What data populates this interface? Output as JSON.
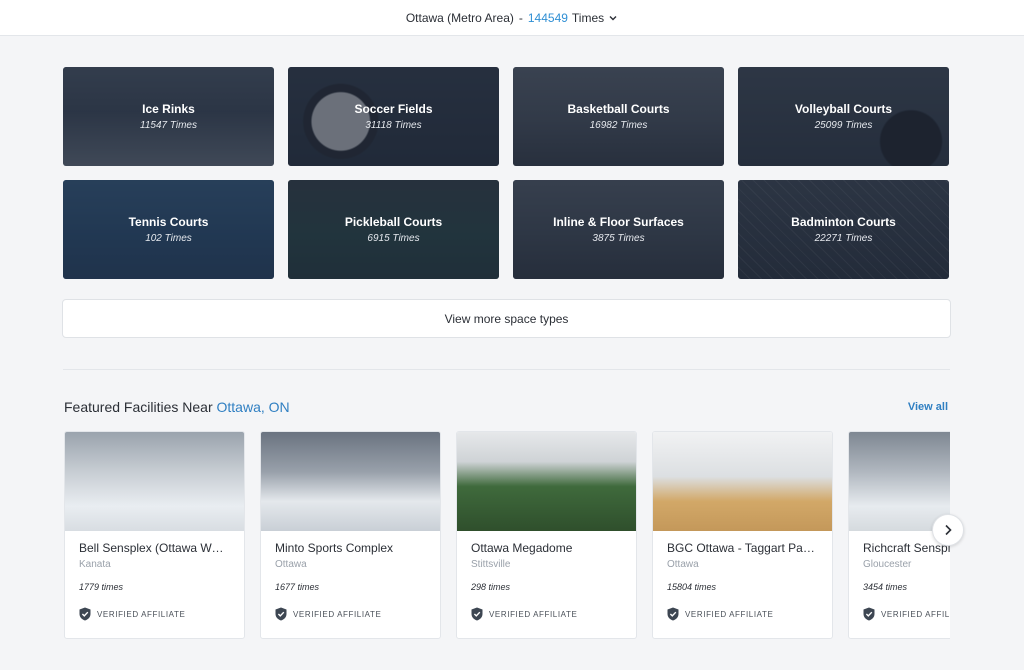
{
  "header": {
    "location": "Ottawa (Metro Area)",
    "separator": "-",
    "count": "144549",
    "unit": "Times"
  },
  "space_types": [
    {
      "name": "Ice Rinks",
      "times": "11547 Times"
    },
    {
      "name": "Soccer Fields",
      "times": "31118 Times"
    },
    {
      "name": "Basketball Courts",
      "times": "16982 Times"
    },
    {
      "name": "Volleyball Courts",
      "times": "25099 Times"
    },
    {
      "name": "Tennis Courts",
      "times": "102 Times"
    },
    {
      "name": "Pickleball Courts",
      "times": "6915 Times"
    },
    {
      "name": "Inline & Floor Surfaces",
      "times": "3875 Times"
    },
    {
      "name": "Badminton Courts",
      "times": "22271 Times"
    }
  ],
  "view_more_label": "View more space types",
  "featured": {
    "title_prefix": "Featured Facilities Near",
    "city": "Ottawa, ON",
    "view_all": "View all",
    "verified_label": "VERIFIED AFFILIATE",
    "facilities": [
      {
        "name": "Bell Sensplex (Ottawa West)",
        "area": "Kanata",
        "times": "1779 times"
      },
      {
        "name": "Minto Sports Complex",
        "area": "Ottawa",
        "times": "1677 times"
      },
      {
        "name": "Ottawa Megadome",
        "area": "Stittsville",
        "times": "298 times"
      },
      {
        "name": "BGC Ottawa - Taggart Parkes",
        "area": "Ottawa",
        "times": "15804 times"
      },
      {
        "name": "Richcraft Sensplex",
        "area": "Gloucester",
        "times": "3454 times"
      }
    ]
  },
  "colors": {
    "accent": "#2f8fd4",
    "link": "#2f7fc2",
    "tile_overlay": "#1a2232"
  },
  "icons": {
    "location_dropdown": "chevron-down-icon",
    "verified": "shield-check-icon",
    "carousel_next": "chevron-right-icon"
  }
}
